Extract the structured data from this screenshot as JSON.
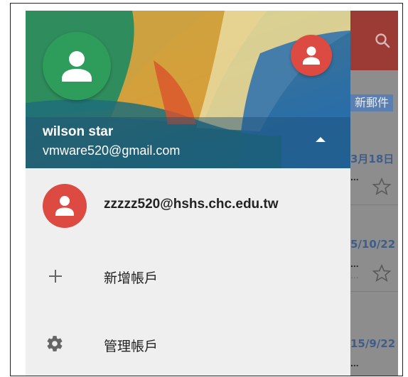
{
  "inbox": {
    "new_mail_label": "新郵件",
    "rows": [
      {
        "date": "3月18日",
        "dots": "...",
        "snip": ""
      },
      {
        "date": "5/10/22",
        "dots": "...",
        "snip": "..."
      },
      {
        "date": "15/9/22",
        "dots": "...",
        "snip": ""
      }
    ]
  },
  "drawer": {
    "current_account": {
      "name": "wilson star",
      "email": "vmware520@gmail.com"
    },
    "other_account_email": "zzzzz520@hshs.chc.edu.tw",
    "add_account_label": "新增帳戶",
    "manage_accounts_label": "管理帳戶"
  },
  "colors": {
    "avatar_green": "#2e9c5a",
    "avatar_red": "#dc4a42"
  }
}
